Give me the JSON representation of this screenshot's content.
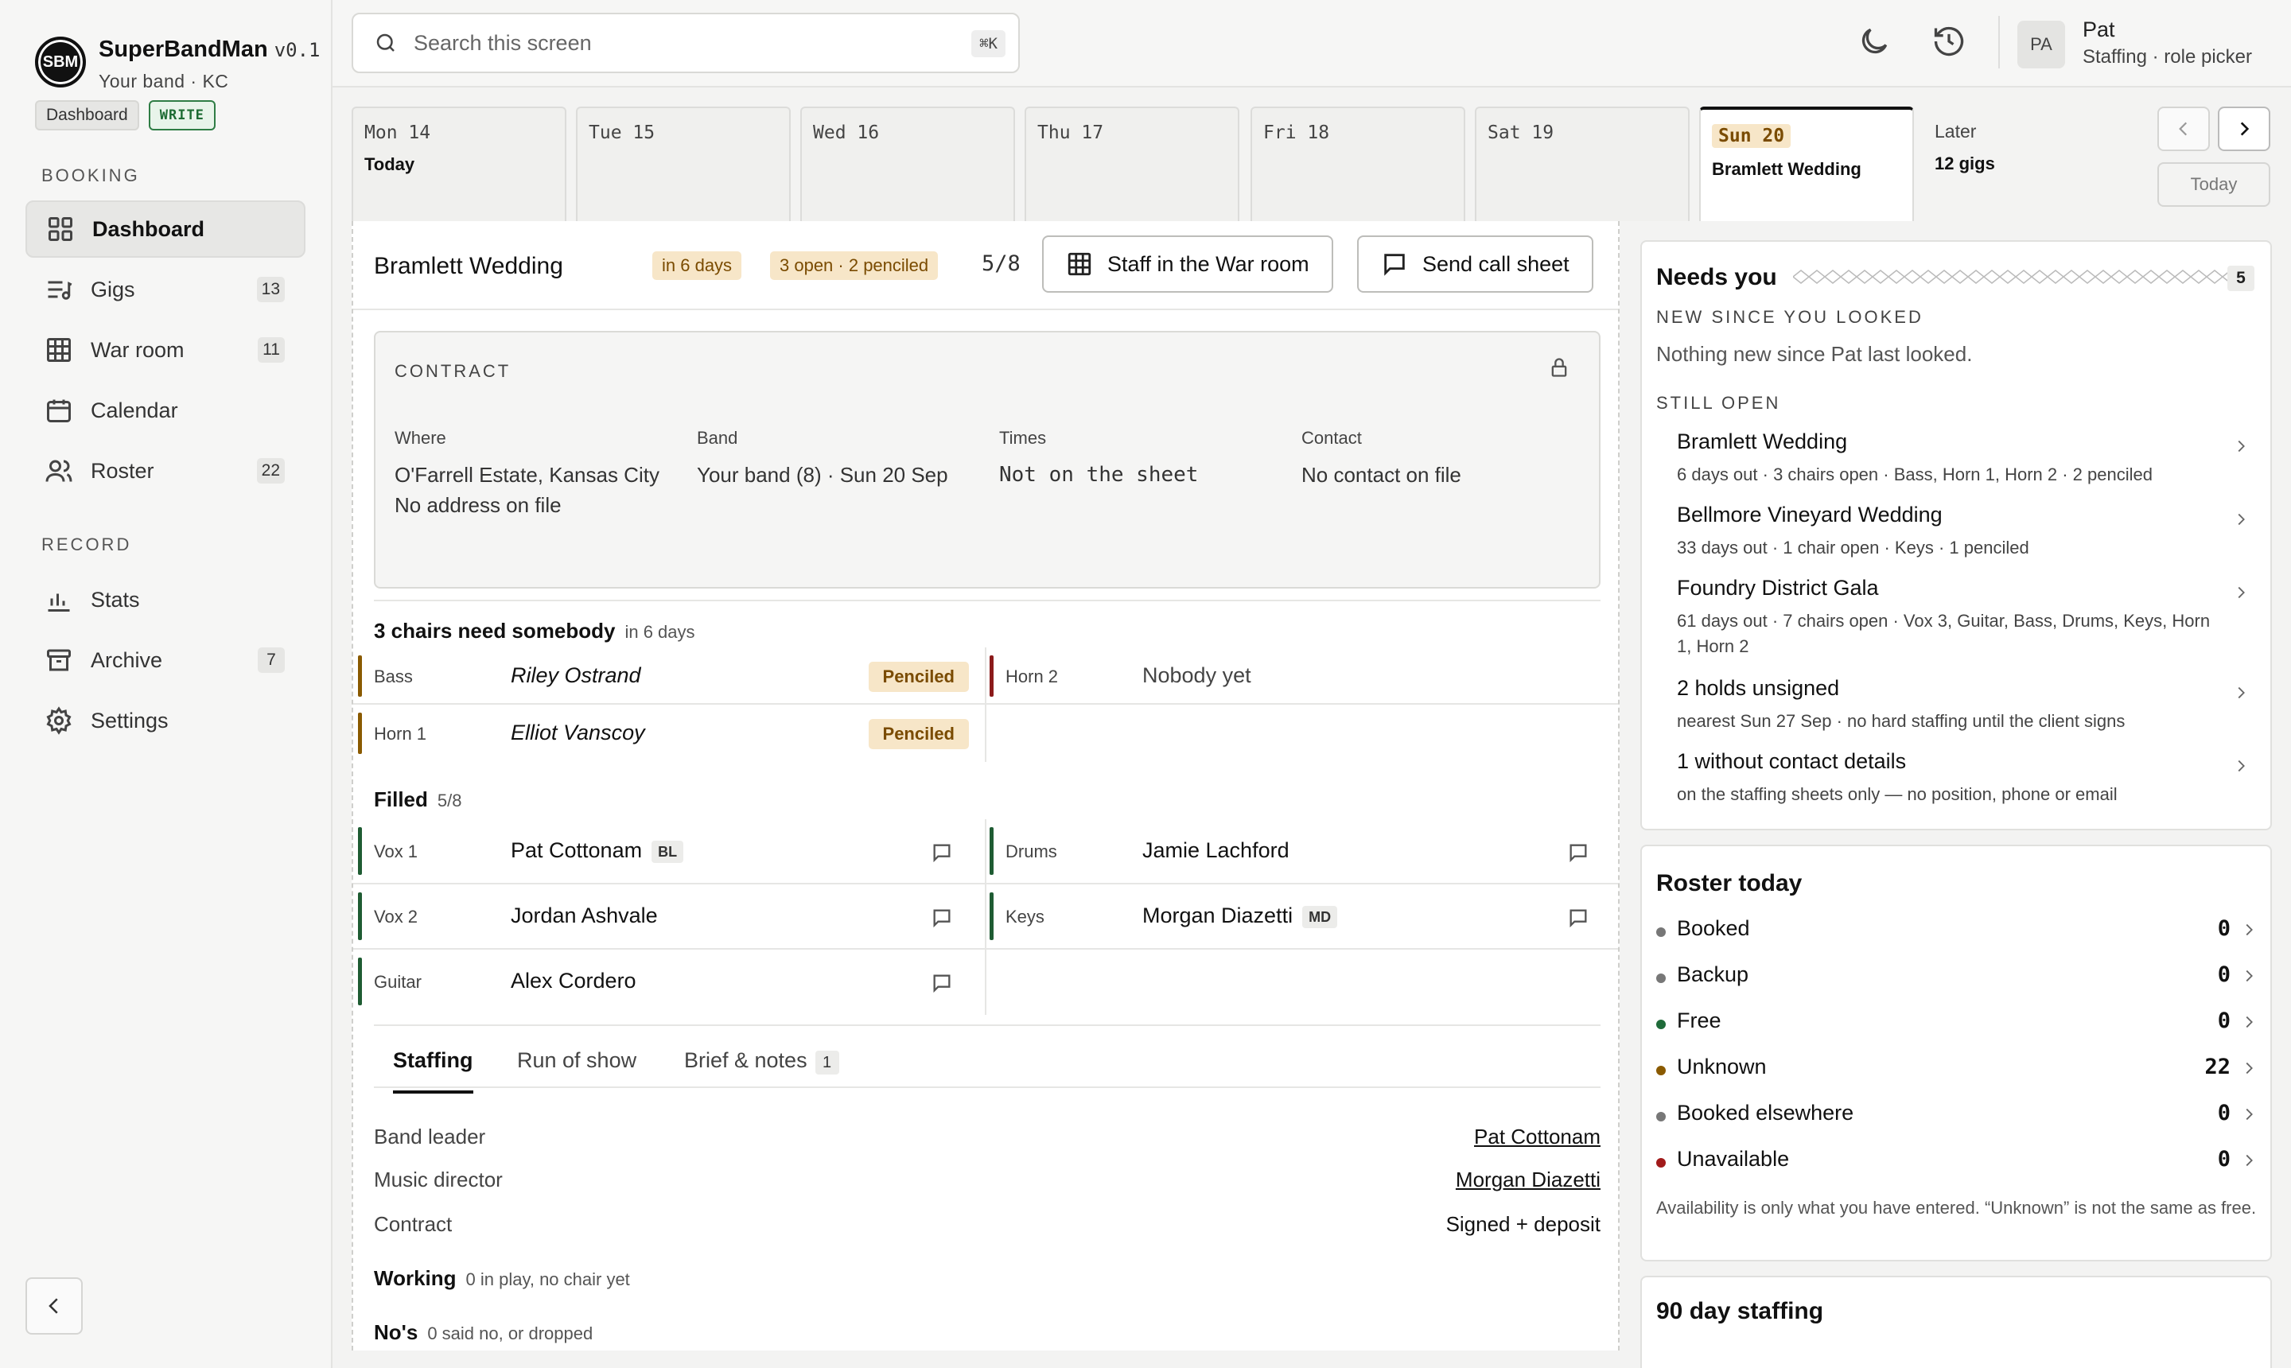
{
  "app": {
    "name": "SuperBandMan",
    "version": "v0.1",
    "subtitle": "Your band · KC",
    "logo": "SBM",
    "mode_pill": "Dashboard",
    "write_pill": "WRITE"
  },
  "sidebar": {
    "booking_label": "BOOKING",
    "record_label": "RECORD",
    "items": [
      {
        "label": "Dashboard",
        "icon": "dashboard-icon",
        "count": ""
      },
      {
        "label": "Gigs",
        "icon": "gigs-icon",
        "count": "13"
      },
      {
        "label": "War room",
        "icon": "grid-icon",
        "count": "11"
      },
      {
        "label": "Calendar",
        "icon": "calendar-icon",
        "count": ""
      },
      {
        "label": "Roster",
        "icon": "people-icon",
        "count": "22"
      },
      {
        "label": "Stats",
        "icon": "bar-chart-icon",
        "count": ""
      },
      {
        "label": "Archive",
        "icon": "archive-icon",
        "count": "7"
      },
      {
        "label": "Settings",
        "icon": "gear-icon",
        "count": ""
      }
    ]
  },
  "topbar": {
    "search_placeholder": "Search this screen",
    "shortcut": "⌘K",
    "user_initials": "PA",
    "user_name": "Pat",
    "user_role": "Staffing · role picker"
  },
  "days": [
    {
      "label": "Mon 14",
      "sub": "Today"
    },
    {
      "label": "Tue 15",
      "sub": ""
    },
    {
      "label": "Wed 16",
      "sub": ""
    },
    {
      "label": "Thu 17",
      "sub": ""
    },
    {
      "label": "Fri 18",
      "sub": ""
    },
    {
      "label": "Sat 19",
      "sub": ""
    },
    {
      "label": "Sun 20",
      "sub": "Bramlett Wedding"
    },
    {
      "label": "Later",
      "sub": "12 gigs"
    }
  ],
  "today_button": "Today",
  "gig": {
    "title": "Bramlett Wedding",
    "badge_when": "in 6 days",
    "badge_status": "3 open · 2 penciled",
    "ratio": "5/8",
    "btn_warroom": "Staff in the War room",
    "btn_callsheet": "Send call sheet",
    "contract": {
      "label": "CONTRACT",
      "where_h": "Where",
      "where_v": "O'Farrell Estate, Kansas City",
      "where_v2": "No address on file",
      "band_h": "Band",
      "band_v": "Your band (8) · Sun 20 Sep",
      "times_h": "Times",
      "times_v": "Not on the sheet",
      "contact_h": "Contact",
      "contact_v": "No contact on file"
    },
    "need_title": "3 chairs need somebody",
    "need_sub": "in 6 days",
    "need": [
      {
        "role": "Bass",
        "name": "Riley Ostrand",
        "tag": "Penciled"
      },
      {
        "role": "Horn 2",
        "name": "Nobody yet",
        "tag": ""
      },
      {
        "role": "Horn 1",
        "name": "Elliot Vanscoy",
        "tag": "Penciled"
      }
    ],
    "filled_title": "Filled",
    "filled_sub": "5/8",
    "filled": [
      {
        "role": "Vox 1",
        "name": "Pat Cottonam",
        "badge": "BL"
      },
      {
        "role": "Drums",
        "name": "Jamie Lachford",
        "badge": ""
      },
      {
        "role": "Vox 2",
        "name": "Jordan Ashvale",
        "badge": ""
      },
      {
        "role": "Keys",
        "name": "Morgan Diazetti",
        "badge": "MD"
      },
      {
        "role": "Guitar",
        "name": "Alex Cordero",
        "badge": ""
      }
    ],
    "tabs": [
      {
        "label": "Staffing",
        "count": ""
      },
      {
        "label": "Run of show",
        "count": ""
      },
      {
        "label": "Brief & notes",
        "count": "1"
      }
    ],
    "staffing": [
      {
        "key": "Band leader",
        "value": "Pat Cottonam"
      },
      {
        "key": "Music director",
        "value": "Morgan Diazetti"
      },
      {
        "key": "Contract",
        "value": "Signed + deposit"
      }
    ],
    "working_title": "Working",
    "working_sub": "0 in play, no chair yet",
    "nos_title": "No's",
    "nos_sub": "0 said no, or dropped"
  },
  "needs": {
    "title": "Needs you",
    "count": "5",
    "new_label": "NEW SINCE YOU LOOKED",
    "new_text": "Nothing new since Pat last looked.",
    "open_label": "STILL OPEN",
    "items": [
      {
        "title": "Bramlett Wedding",
        "detail": "6 days out · 3 chairs open · Bass, Horn 1, Horn 2 · 2 penciled"
      },
      {
        "title": "Bellmore Vineyard Wedding",
        "detail": "33 days out · 1 chair open · Keys · 1 penciled"
      },
      {
        "title": "Foundry District Gala",
        "detail": "61 days out · 7 chairs open · Vox 3, Guitar, Bass, Drums, Keys, Horn 1, Horn 2"
      },
      {
        "title": "2 holds unsigned",
        "detail": "nearest Sun 27 Sep · no hard staffing until the client signs"
      },
      {
        "title": "1 without contact details",
        "detail": "on the staffing sheets only — no position, phone or email"
      }
    ]
  },
  "roster": {
    "title": "Roster today",
    "items": [
      {
        "label": "Booked",
        "count": "0",
        "color": "#777777"
      },
      {
        "label": "Backup",
        "count": "0",
        "color": "#777777"
      },
      {
        "label": "Free",
        "count": "0",
        "color": "#1f6b3a"
      },
      {
        "label": "Unknown",
        "count": "22",
        "color": "#8a5a00"
      },
      {
        "label": "Booked elsewhere",
        "count": "0",
        "color": "#777777"
      },
      {
        "label": "Unavailable",
        "count": "0",
        "color": "#a11a1a"
      }
    ],
    "note": "Availability is only what you have entered. “Unknown” is not the same as free."
  },
  "staffing90": {
    "title": "90 day staffing"
  },
  "colors": {
    "filled": "#1f5c33",
    "penciled": "#8a5a00",
    "open": "#8b1a1a"
  }
}
